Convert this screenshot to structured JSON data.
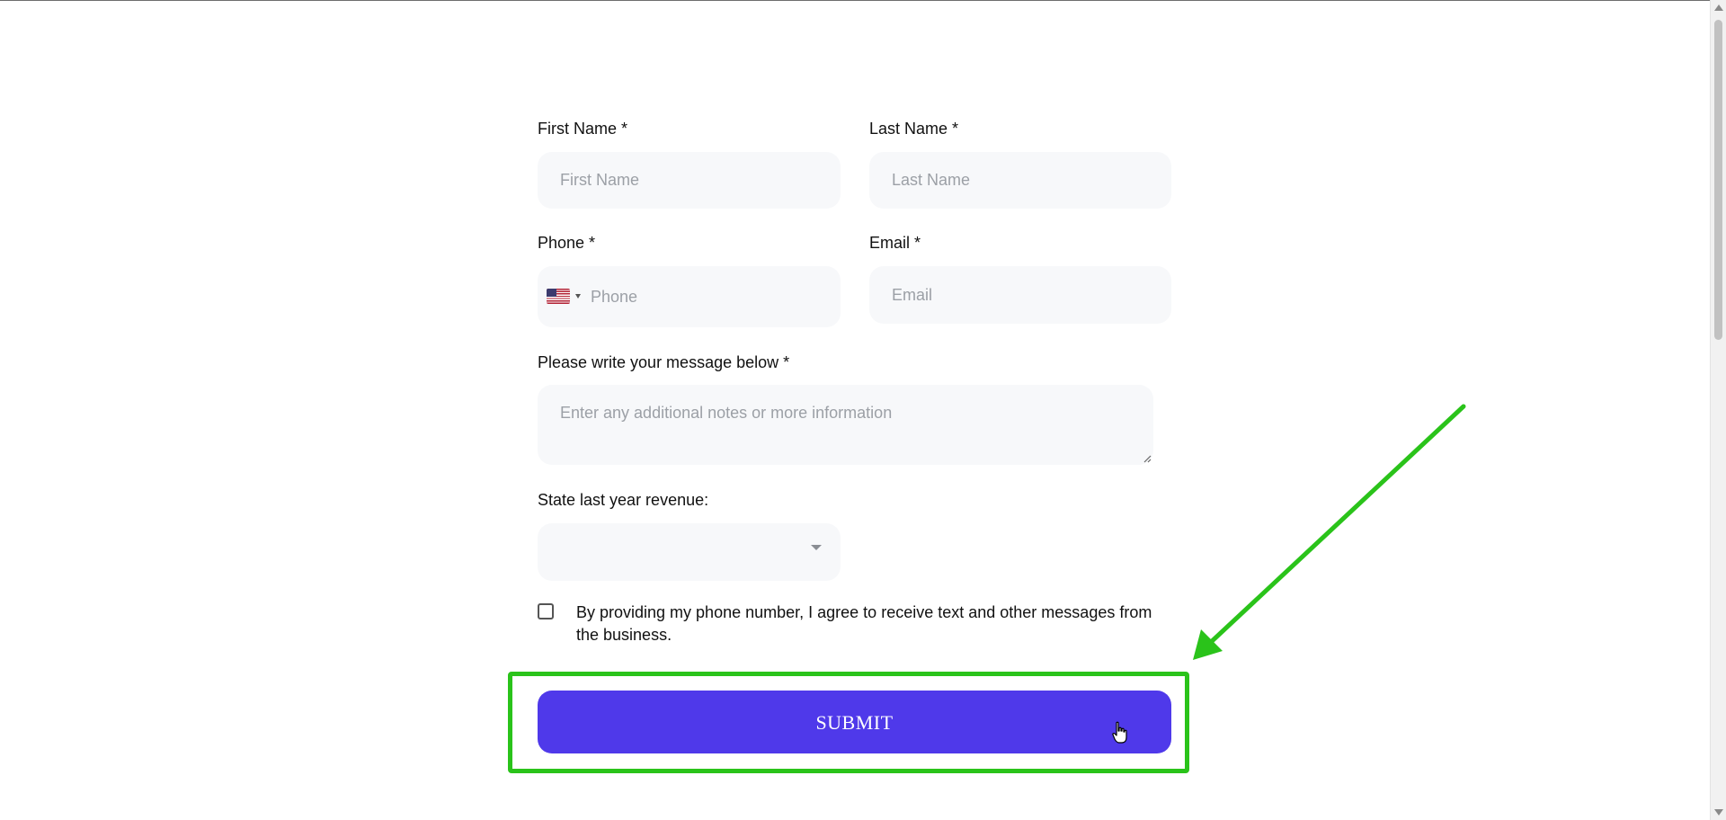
{
  "form": {
    "first_name": {
      "label": "First Name *",
      "placeholder": "First Name",
      "value": ""
    },
    "last_name": {
      "label": "Last Name *",
      "placeholder": "Last Name",
      "value": ""
    },
    "phone": {
      "label": "Phone *",
      "placeholder": "Phone",
      "value": "",
      "country_flag": "us-flag-icon"
    },
    "email": {
      "label": "Email *",
      "placeholder": "Email",
      "value": ""
    },
    "message": {
      "label": "Please write your message below *",
      "placeholder": "Enter any additional notes or more information",
      "value": ""
    },
    "revenue": {
      "label": "State last year revenue:",
      "selected": ""
    },
    "consent": {
      "text": "By providing my phone number, I agree to receive text and other messages from the business.",
      "checked": false
    },
    "submit_label": "SUBMIT"
  },
  "annotation": {
    "highlight_color": "#2ac31a",
    "target": "submit-button"
  },
  "colors": {
    "submit_bg": "#4f39ea",
    "field_bg": "#f7f8fa"
  }
}
